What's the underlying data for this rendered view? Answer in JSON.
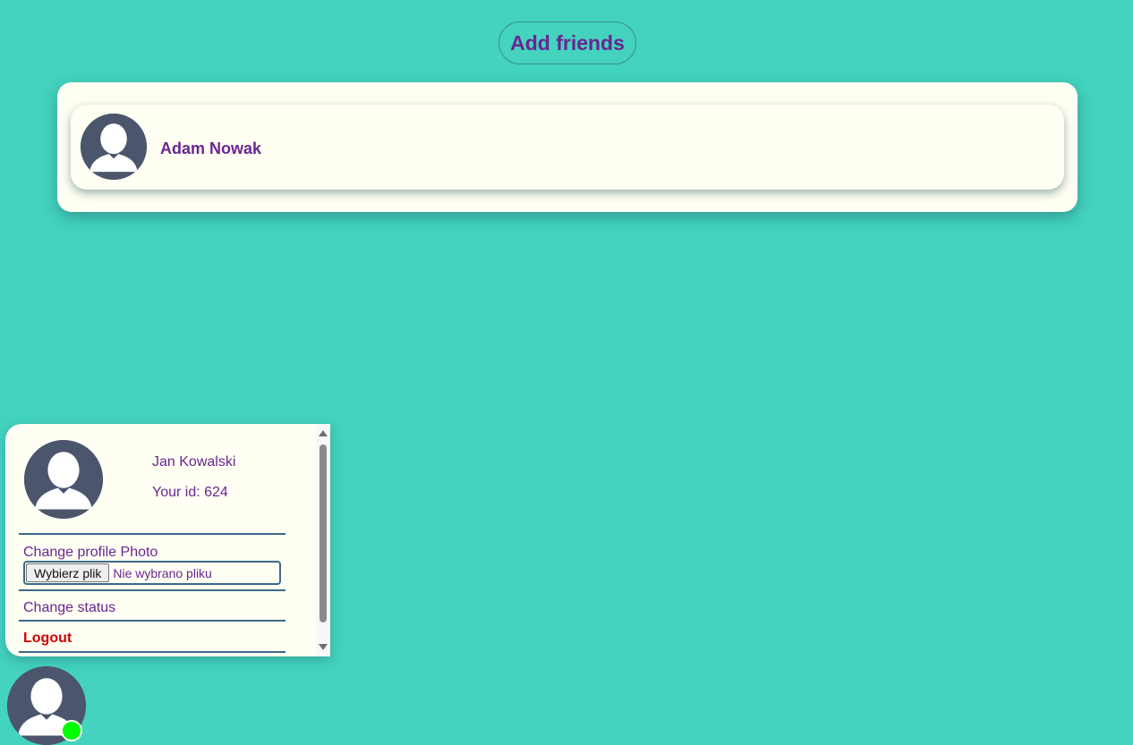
{
  "header": {
    "add_friends_label": "Add friends"
  },
  "friends": [
    {
      "name": "Adam Nowak",
      "avatar_icon": "user-silhouette-icon"
    }
  ],
  "profile": {
    "name": "Jan Kowalski",
    "id_text": "Your id: 624",
    "avatar_icon": "user-silhouette-icon",
    "change_photo_label": "Change profile Photo",
    "file_button_label": "Wybierz plik",
    "file_status": "Nie wybrano pliku",
    "change_status_label": "Change status",
    "logout_label": "Logout"
  },
  "user": {
    "avatar_icon": "user-silhouette-icon",
    "status": "online"
  },
  "colors": {
    "background": "#43d3be",
    "panel": "#fffff3",
    "accent_text": "#6a2591",
    "logout": "#d20000",
    "online": "#00ff00",
    "avatar": "#4b566d"
  }
}
